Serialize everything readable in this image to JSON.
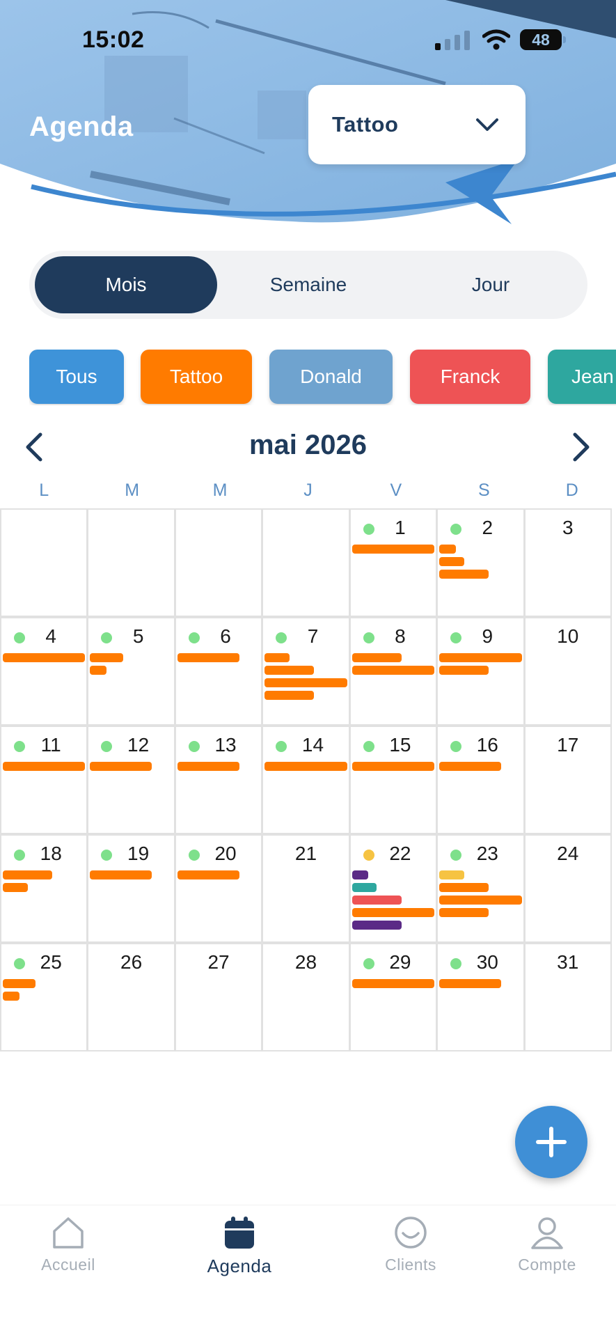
{
  "status_bar": {
    "time": "15:02",
    "battery": "48"
  },
  "header": {
    "title": "Agenda",
    "studio_select": {
      "value": "Tattoo"
    }
  },
  "view_toggle": {
    "options": [
      "Mois",
      "Semaine",
      "Jour"
    ],
    "active": "Mois"
  },
  "filters": [
    {
      "label": "Tous",
      "color": "#3e93d9"
    },
    {
      "label": "Tattoo",
      "color": "#ff7b00"
    },
    {
      "label": "Donald",
      "color": "#6fa3cf"
    },
    {
      "label": "Franck",
      "color": "#ee5355"
    },
    {
      "label": "Jean",
      "color": "#2ea79f"
    }
  ],
  "calendar": {
    "month_label": "mai 2026",
    "weekdays": [
      "L",
      "M",
      "M",
      "J",
      "V",
      "S",
      "D"
    ],
    "weeks": [
      [
        {
          "day": ""
        },
        {
          "day": ""
        },
        {
          "day": ""
        },
        {
          "day": ""
        },
        {
          "day": "1",
          "dot": "green",
          "events": [
            "#ff7b00"
          ]
        },
        {
          "day": "2",
          "dot": "green",
          "events": [
            "#ff7b00",
            "#ff7b00",
            "#ff7b00"
          ]
        },
        {
          "day": "3"
        }
      ],
      [
        {
          "day": "4",
          "dot": "green",
          "events": [
            "#ff7b00"
          ]
        },
        {
          "day": "5",
          "dot": "green",
          "events": [
            "#ff7b00",
            "#ff7b00"
          ]
        },
        {
          "day": "6",
          "dot": "green",
          "events": [
            "#ff7b00"
          ]
        },
        {
          "day": "7",
          "dot": "green",
          "events": [
            "#ff7b00",
            "#ff7b00",
            "#ff7b00",
            "#ff7b00"
          ]
        },
        {
          "day": "8",
          "dot": "green",
          "events": [
            "#ff7b00",
            "#ff7b00"
          ]
        },
        {
          "day": "9",
          "dot": "green",
          "events": [
            "#ff7b00",
            "#ff7b00"
          ]
        },
        {
          "day": "10"
        }
      ],
      [
        {
          "day": "11",
          "dot": "green",
          "events": [
            "#ff7b00"
          ]
        },
        {
          "day": "12",
          "dot": "green",
          "events": [
            "#ff7b00"
          ]
        },
        {
          "day": "13",
          "dot": "green",
          "events": [
            "#ff7b00"
          ]
        },
        {
          "day": "14",
          "dot": "green",
          "events": [
            "#ff7b00"
          ]
        },
        {
          "day": "15",
          "dot": "green",
          "events": [
            "#ff7b00"
          ]
        },
        {
          "day": "16",
          "dot": "green",
          "events": [
            "#ff7b00"
          ]
        },
        {
          "day": "17"
        }
      ],
      [
        {
          "day": "18",
          "dot": "green",
          "events": [
            "#ff7b00",
            "#ff7b00"
          ]
        },
        {
          "day": "19",
          "dot": "green",
          "events": [
            "#ff7b00"
          ]
        },
        {
          "day": "20",
          "dot": "green",
          "events": [
            "#ff7b00"
          ]
        },
        {
          "day": "21"
        },
        {
          "day": "22",
          "dot": "yellow",
          "events": [
            "#5b2a86",
            "#2ea79f",
            "#ee5355",
            "#ff7b00",
            "#5b2a86"
          ]
        },
        {
          "day": "23",
          "dot": "green",
          "events": [
            "#f6c342",
            "#ff7b00",
            "#ff7b00",
            "#ff7b00"
          ]
        },
        {
          "day": "24"
        }
      ],
      [
        {
          "day": "25",
          "dot": "green",
          "events": [
            "#ff7b00",
            "#ff7b00"
          ]
        },
        {
          "day": "26"
        },
        {
          "day": "27"
        },
        {
          "day": "28"
        },
        {
          "day": "29",
          "dot": "green",
          "events": [
            "#ff7b00"
          ]
        },
        {
          "day": "30",
          "dot": "green",
          "events": [
            "#ff7b00"
          ]
        },
        {
          "day": "31"
        }
      ]
    ]
  },
  "bottom_nav": [
    {
      "label": "Accueil",
      "icon": "home-icon",
      "active": false
    },
    {
      "label": "Agenda",
      "icon": "calendar-icon",
      "active": true
    },
    {
      "label": "Clients",
      "icon": "smiley-icon",
      "active": false
    },
    {
      "label": "Compte",
      "icon": "user-icon",
      "active": false
    }
  ]
}
